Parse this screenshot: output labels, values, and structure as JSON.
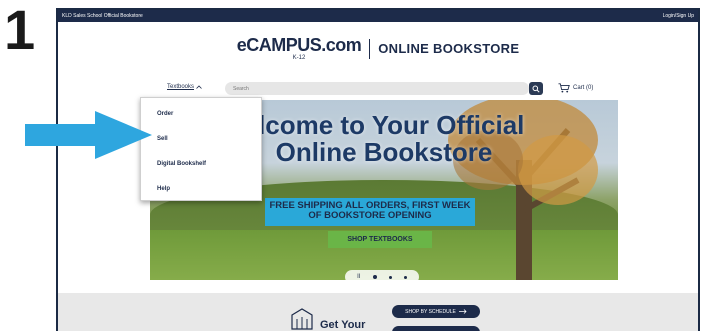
{
  "step": "1",
  "topbar": {
    "school": "KLD Sales School Official Bookstore",
    "login": "Login/Sign Up"
  },
  "logo": {
    "brand": "eCAMPUS.com",
    "sub": "K-12",
    "store_title": "ONLINE BOOKSTORE"
  },
  "nav": {
    "textbooks": "Textbooks",
    "search_placeholder": "Search",
    "cart": "Cart (0)"
  },
  "hero": {
    "title_line1": "elcome to Your Official",
    "title_line2": "Online Bookstore",
    "banner": "FREE SHIPPING ALL ORDERS, FIRST WEEK OF BOOKSTORE OPENING",
    "shop_button": "SHOP TEXTBOOKS",
    "pause": "II"
  },
  "dropdown": {
    "items": [
      "Order",
      "Sell",
      "Digital Bookshelf",
      "Help"
    ]
  },
  "bottom": {
    "get_your": "Get Your",
    "schedule_button": "SHOP BY SCHEDULE"
  },
  "colors": {
    "navy": "#1d2b4a",
    "banner_blue": "#2aa8d8",
    "shop_green": "#6ab547",
    "arrow_blue": "#2ea6df"
  }
}
